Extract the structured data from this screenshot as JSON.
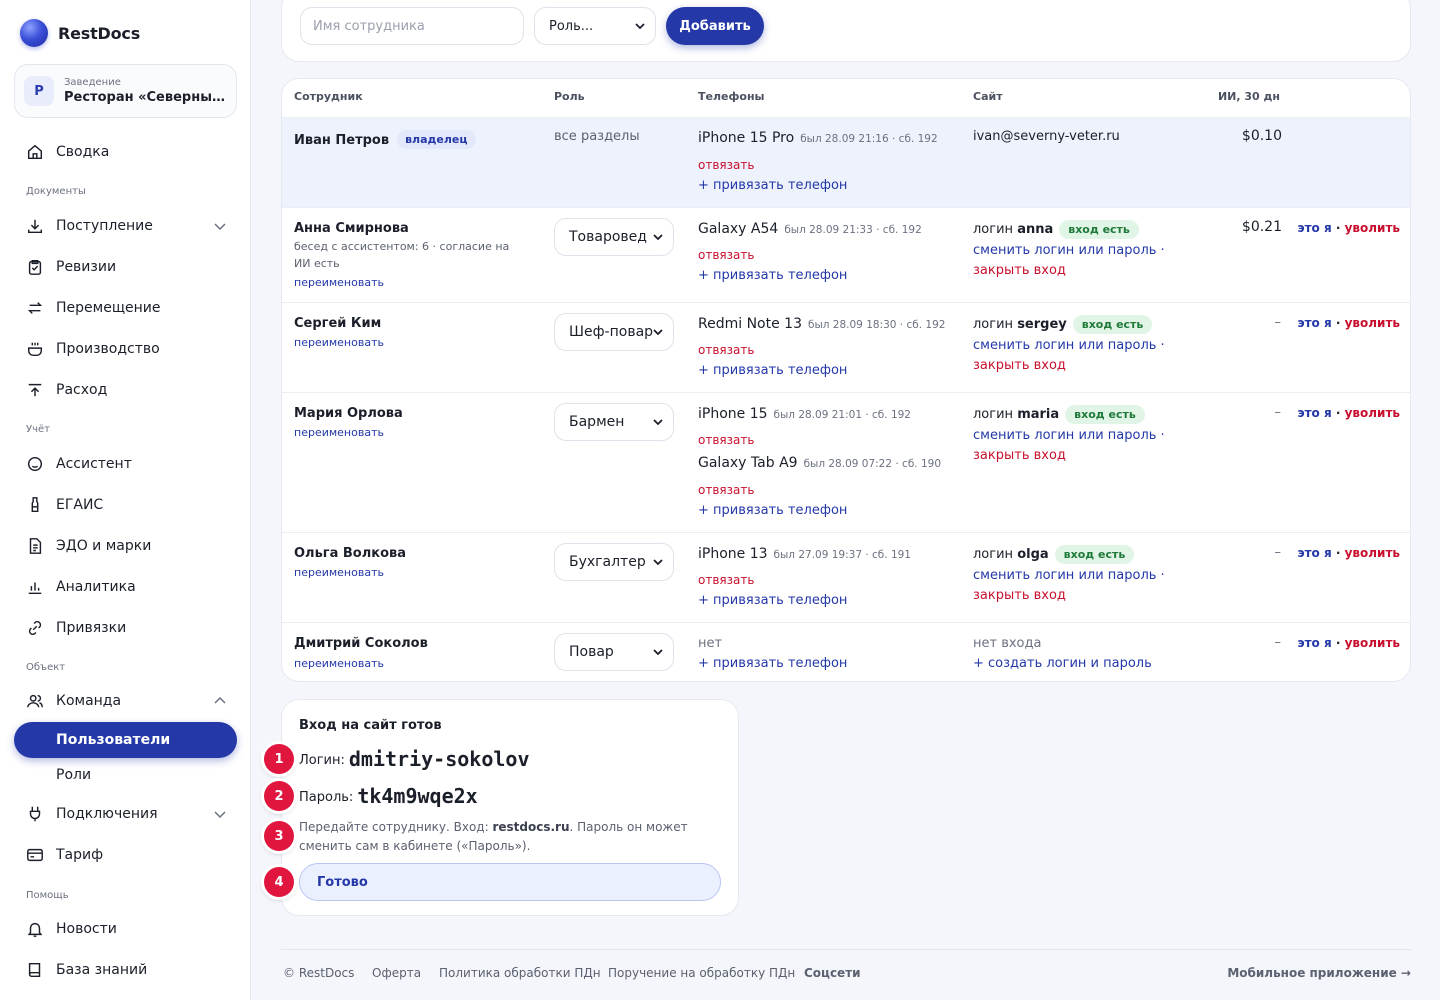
{
  "brand": {
    "name": "RestDocs"
  },
  "venue": {
    "label": "Заведение",
    "initial": "Р",
    "name": "Ресторан «Северный ветер»"
  },
  "nav": {
    "summary": "Сводка",
    "sec_docs": "Документы",
    "intake": "Поступление",
    "audits": "Ревизии",
    "transfer": "Перемещение",
    "production": "Производство",
    "expense": "Расход",
    "sec_account": "Учёт",
    "assistant": "Ассистент",
    "egais": "ЕГАИС",
    "edo": "ЭДО и марки",
    "analytics": "Аналитика",
    "bindings": "Привязки",
    "sec_object": "Объект",
    "team": "Команда",
    "users": "Пользователи",
    "roles": "Роли",
    "connections": "Подключения",
    "tariff": "Тариф",
    "sec_help": "Помощь",
    "news": "Новости",
    "kb": "База знаний"
  },
  "add_form": {
    "name_placeholder": "Имя сотрудника",
    "role_placeholder": "Роль...",
    "add_label": "Добавить"
  },
  "table": {
    "headers": {
      "employee": "Сотрудник",
      "role": "Роль",
      "phones": "Телефоны",
      "site": "Сайт",
      "ai": "ИИ, 30 дн"
    },
    "unbind": "отвязать",
    "bind_phone": "+ привязать телефон",
    "rename": "переименовать",
    "login_prefix": "логин",
    "login_ok": "вход есть",
    "change_creds": "сменить логин или пароль ·",
    "close_login": "закрыть вход",
    "its_me": "это я",
    "sep": "·",
    "fire": "уволить",
    "dash": "–",
    "rows": [
      {
        "name": "Иван Петров",
        "badge": "владелец",
        "role": "все разделы",
        "phone1": "iPhone 15 Pro",
        "meta1": "был 28.09 21:16 · сб. 192",
        "site": "ivan@severny-veter.ru",
        "cost": "$0.10"
      },
      {
        "name": "Анна Смирнова",
        "sub": "бесед с ассистентом: 6 · согласие на ИИ есть",
        "role": "Товаровед",
        "phone1": "Galaxy A54",
        "meta1": "был 28.09 21:33 · сб. 192",
        "login": "anna",
        "cost": "$0.21"
      },
      {
        "name": "Сергей Ким",
        "role": "Шеф-повар",
        "phone1": "Redmi Note 13",
        "meta1": "был 28.09 18:30 · сб. 192",
        "login": "sergey"
      },
      {
        "name": "Мария Орлова",
        "role": "Бармен",
        "phone1": "iPhone 15",
        "meta1": "был 28.09 21:01 · сб. 192",
        "phone2": "Galaxy Tab A9",
        "meta2": "был 28.09 07:22 · сб. 190",
        "login": "maria"
      },
      {
        "name": "Ольга Волкова",
        "role": "Бухгалтер",
        "phone1": "iPhone 13",
        "meta1": "был 27.09 19:37 · сб. 191",
        "login": "olga"
      },
      {
        "name": "Дмитрий Соколов",
        "role": "Повар",
        "phone1": "нет",
        "site": "нет входа",
        "create_login": "+ создать логин и пароль"
      }
    ]
  },
  "done": {
    "title": "Вход на сайт готов",
    "login_label": "Логин:",
    "login_value": "dmitriy-sokolov",
    "password_label": "Пароль:",
    "password_value": "tk4m9wqe2x",
    "note_a": "Передайте сотруднику. Вход: ",
    "note_site": "restdocs.ru",
    "note_b": ". Пароль он может сменить сам в кабинете («Пароль»).",
    "button": "Готово",
    "steps": [
      "1",
      "2",
      "3",
      "4"
    ]
  },
  "footer": {
    "copyright": "© RestDocs",
    "offer": "Оферта",
    "privacy": "Политика обработки ПДн",
    "assignment": "Поручение на обработку ПДн",
    "social": "Соцсети",
    "mobile": "Мобильное приложение →"
  },
  "colors": {
    "accent": "#2438a8",
    "danger": "#c8102e",
    "step": "#e0163f",
    "ok_bg": "#e1f5e6",
    "ok_text": "#1f7a3a",
    "highlight_row": "#eef2fd"
  }
}
